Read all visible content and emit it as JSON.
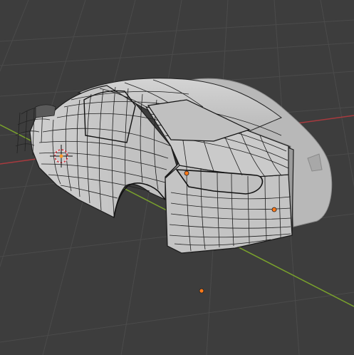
{
  "viewport": {
    "name": "3D Viewport",
    "background_color": "#3d3d3d",
    "grid_line_color": "#4a4a4a",
    "x_axis_color": "#a83a3e",
    "y_axis_color": "#7aa22c",
    "mesh_fill_color": "#b9b9b9",
    "mesh_shadow_color": "#8a8a8a",
    "wire_color": "#1c1c1c",
    "point_color": "#ff7a1a"
  },
  "scene": {
    "object": "car-body-mesh",
    "view_mode": "solid-with-wireframe-overlay",
    "origin_markers": 3,
    "cursor_icon": "3d-cursor-icon"
  }
}
